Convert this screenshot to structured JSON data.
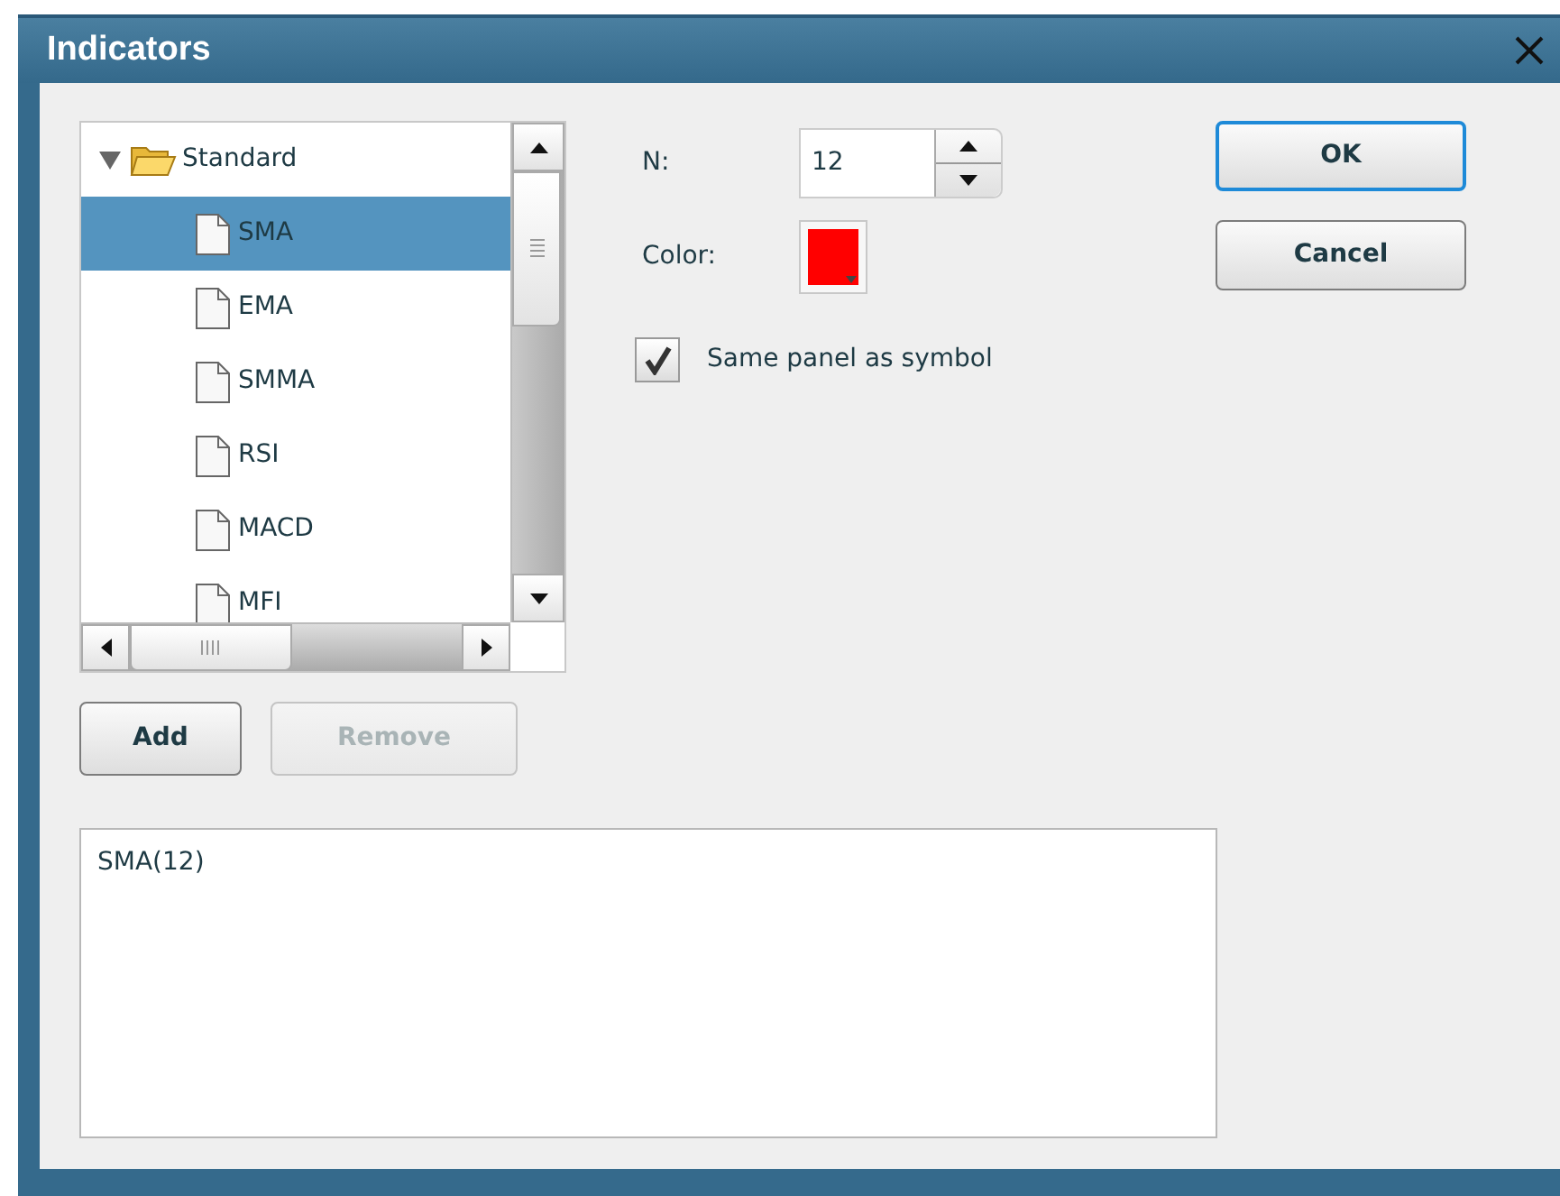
{
  "window": {
    "title": "Indicators"
  },
  "tree": [
    {
      "label": "Standard",
      "expanded": true,
      "children": [
        {
          "label": "SMA",
          "selected": true
        },
        {
          "label": "EMA",
          "selected": false
        },
        {
          "label": "SMMA",
          "selected": false
        },
        {
          "label": "RSI",
          "selected": false
        },
        {
          "label": "MACD",
          "selected": false
        },
        {
          "label": "MFI",
          "selected": false
        }
      ]
    }
  ],
  "n_field": {
    "label": "N:",
    "value": "12"
  },
  "color_field": {
    "label": "Color:",
    "color": "#ff0000"
  },
  "same_panel": {
    "label": "Same panel as symbol",
    "checked": true
  },
  "list_buttons": [
    {
      "label": "Add",
      "disabled": false
    },
    {
      "label": "Remove",
      "disabled": true
    }
  ],
  "dialog_buttons": [
    {
      "label": "OK",
      "default": true
    },
    {
      "label": "Cancel",
      "default": false
    }
  ],
  "output": {
    "value": "SMA(12)"
  }
}
